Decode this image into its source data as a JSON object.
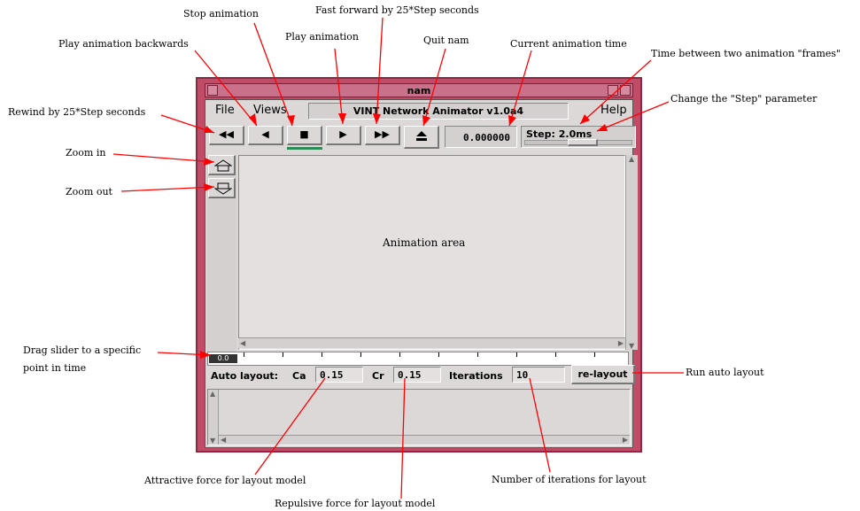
{
  "window": {
    "title": "nam",
    "menu": {
      "file": "File",
      "views": "Views",
      "help": "Help"
    },
    "app_title": "VINT Network Animator v1.0a4",
    "toolbar": {
      "rewind_icon": "◀◀",
      "play_backwards_icon": "◀",
      "stop_icon": "■",
      "play_icon": "▶",
      "fast_forward_icon": "▶▶",
      "quit_icon": "eject-icon"
    },
    "time_display": "0.000000",
    "step_display": "Step: 2.0ms",
    "canvas_label": "Animation area",
    "timeline_marker": "0.0",
    "layout": {
      "auto_layout_label": "Auto layout:",
      "ca_label": "Ca",
      "ca_value": "0.15",
      "cr_label": "Cr",
      "cr_value": "0.15",
      "iterations_label": "Iterations",
      "iterations_value": "10",
      "relayout_button": "re-layout"
    }
  },
  "annotations": {
    "stop": "Stop animation",
    "fast_forward": "Fast forward by 25*Step seconds",
    "play_backwards": "Play animation backwards",
    "play": "Play animation",
    "quit": "Quit nam",
    "current_time": "Current animation time",
    "frame_time": "Time between two animation \"frames\"",
    "rewind": "Rewind by 25*Step seconds",
    "change_step": "Change the \"Step\" parameter",
    "zoom_in": "Zoom in",
    "zoom_out": "Zoom out",
    "drag_slider_1": "Drag slider to a specific",
    "drag_slider_2": "point in time",
    "run_layout": "Run auto layout",
    "attractive": "Attractive force for layout model",
    "repulsive": "Repulsive force for layout model",
    "iterations": "Number of iterations for layout"
  },
  "colors": {
    "frame": "#c04c68",
    "annotation_line": "#ff0000",
    "play_indicator": "#2e8b57"
  }
}
